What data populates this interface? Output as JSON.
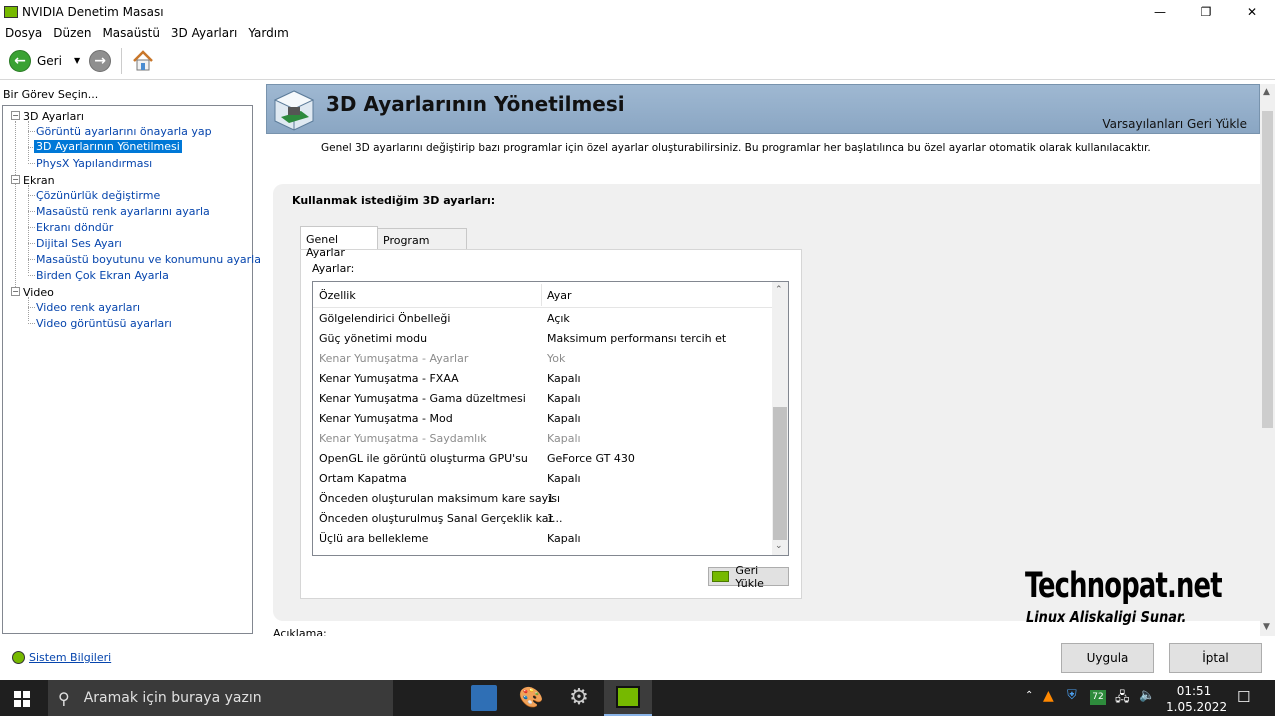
{
  "window": {
    "title": "NVIDIA Denetim Masası"
  },
  "menu": [
    "Dosya",
    "Düzen",
    "Masaüstü",
    "3D Ayarları",
    "Yardım"
  ],
  "toolbar": {
    "back_label": "Geri"
  },
  "left": {
    "task_label": "Bir Görev Seçin...",
    "tree": [
      {
        "label": "3D Ayarları",
        "children": [
          "Görüntü ayarlarını önayarla yap",
          "3D Ayarlarının Yönetilmesi",
          "PhysX Yapılandırması"
        ]
      },
      {
        "label": "Ekran",
        "children": [
          "Çözünürlük değiştirme",
          "Masaüstü renk ayarlarını ayarla",
          "Ekranı döndür",
          "Dijital Ses Ayarı",
          "Masaüstü boyutunu ve konumunu ayarla",
          "Birden Çok Ekran Ayarla"
        ]
      },
      {
        "label": "Video",
        "children": [
          "Video renk ayarları",
          "Video görüntüsü ayarları"
        ]
      }
    ],
    "selected": "3D Ayarlarının Yönetilmesi"
  },
  "main": {
    "heading": "3D Ayarlarının Yönetilmesi",
    "restore_defaults": "Varsayılanları Geri Yükle",
    "description": "Genel 3D ayarlarını değiştirip bazı programlar için özel ayarlar oluşturabilirsiniz. Bu programlar her başlatılınca bu özel ayarlar otomatik olarak kullanılacaktır.",
    "group_title": "Kullanmak istediğim 3D ayarları:",
    "tabs": [
      "Genel Ayarlar",
      "Program Ayarları"
    ],
    "settings_label": "Ayarlar:",
    "columns": [
      "Özellik",
      "Ayar"
    ],
    "rows": [
      {
        "feature": "Gölgelendirici Önbelleği",
        "value": "Açık",
        "disabled": false
      },
      {
        "feature": "Güç yönetimi modu",
        "value": "Maksimum performansı tercih et",
        "disabled": false
      },
      {
        "feature": "Kenar Yumuşatma - Ayarlar",
        "value": "Yok",
        "disabled": true
      },
      {
        "feature": "Kenar Yumuşatma - FXAA",
        "value": "Kapalı",
        "disabled": false
      },
      {
        "feature": "Kenar Yumuşatma - Gama düzeltmesi",
        "value": "Kapalı",
        "disabled": false
      },
      {
        "feature": "Kenar Yumuşatma - Mod",
        "value": "Kapalı",
        "disabled": false
      },
      {
        "feature": "Kenar Yumuşatma - Saydamlık",
        "value": "Kapalı",
        "disabled": true
      },
      {
        "feature": "OpenGL ile görüntü oluşturma GPU'su",
        "value": "GeForce GT 430",
        "disabled": false
      },
      {
        "feature": "Ortam Kapatma",
        "value": "Kapalı",
        "disabled": false
      },
      {
        "feature": "Önceden oluşturulan maksimum kare sayısı",
        "value": "1",
        "disabled": false
      },
      {
        "feature": "Önceden oluşturulmuş Sanal Gerçeklik kar...",
        "value": "1",
        "disabled": false
      },
      {
        "feature": "Üçlü ara bellekleme",
        "value": "Kapalı",
        "disabled": false
      }
    ],
    "reset_button": "Geri Yükle",
    "partial_label": "Açıklama:"
  },
  "bottom": {
    "system_info": "Sistem Bilgileri",
    "apply": "Uygula",
    "cancel": "İptal"
  },
  "watermark": {
    "line1": "Technopat.net",
    "line2": "Linux Aliskaligi Sunar."
  },
  "taskbar": {
    "search_placeholder": "Aramak için buraya yazın",
    "battery_badge": "72",
    "time": "01:51",
    "date": "1.05.2022"
  }
}
